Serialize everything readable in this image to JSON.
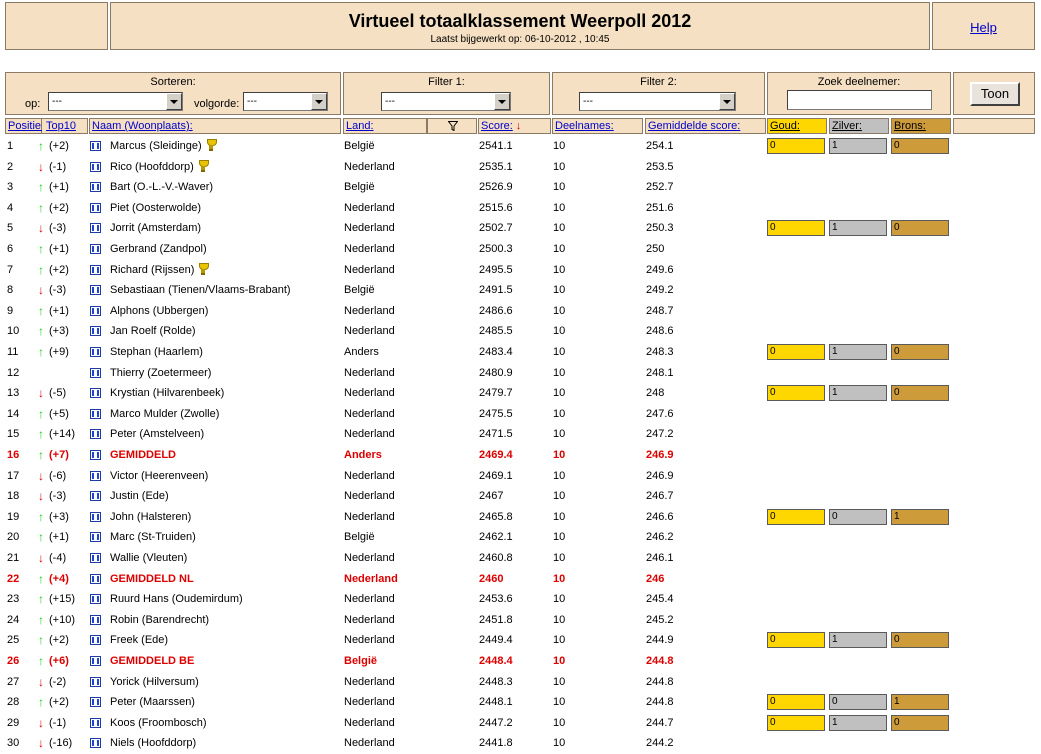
{
  "header": {
    "title": "Virtueel totaalklassement Weerpoll 2012",
    "subtitle": "Laatst bijgewerkt op: 06-10-2012 , 10:45",
    "help": "Help"
  },
  "controls": {
    "sort_label": "Sorteren:",
    "op_label": "op:",
    "op_value": "---",
    "volgorde_label": "volgorde:",
    "volgorde_value": "---",
    "filter1_label": "Filter 1:",
    "filter1_value": "---",
    "filter2_label": "Filter 2:",
    "filter2_value": "---",
    "search_label": "Zoek deelnemer:",
    "search_value": "",
    "show_button": "Toon"
  },
  "columns": {
    "positie": "Positie:",
    "top10": "Top10",
    "naam": "Naam (Woonplaats):",
    "land": "Land:",
    "score": "Score:",
    "deelnames": "Deelnames:",
    "gemiddelde": "Gemiddelde score:",
    "goud": "Goud:",
    "zilver": "Zilver:",
    "brons": "Brons:"
  },
  "icons": {
    "filter": "filter-funnel-icon",
    "sort": "sort-down-arrow-icon",
    "up": "↑",
    "down": "↓",
    "team": "profile-icon",
    "trophy": "trophy-icon"
  },
  "colors": {
    "panel": "#f5e0c3",
    "gold": "#ffd700",
    "silver": "#c0c0c0",
    "bronze": "#cd9b3a",
    "highlight": "#dd0000",
    "up": "#22cc22",
    "down": "#dd0000"
  },
  "rows": [
    {
      "pos": "1",
      "dir": "up",
      "change": "(+2)",
      "name": "Marcus (Sleidinge)",
      "trophy": true,
      "land": "België",
      "score": "2541.1",
      "deel": "10",
      "gem": "254.1",
      "medals": [
        "0",
        "1",
        "0"
      ]
    },
    {
      "pos": "2",
      "dir": "down",
      "change": "(-1)",
      "name": "Rico (Hoofddorp)",
      "trophy": true,
      "land": "Nederland",
      "score": "2535.1",
      "deel": "10",
      "gem": "253.5"
    },
    {
      "pos": "3",
      "dir": "up",
      "change": "(+1)",
      "name": "Bart (O.-L.-V.-Waver)",
      "land": "België",
      "score": "2526.9",
      "deel": "10",
      "gem": "252.7"
    },
    {
      "pos": "4",
      "dir": "up",
      "change": "(+2)",
      "name": "Piet (Oosterwolde)",
      "land": "Nederland",
      "score": "2515.6",
      "deel": "10",
      "gem": "251.6"
    },
    {
      "pos": "5",
      "dir": "down",
      "change": "(-3)",
      "name": "Jorrit (Amsterdam)",
      "land": "Nederland",
      "score": "2502.7",
      "deel": "10",
      "gem": "250.3",
      "medals": [
        "0",
        "1",
        "0"
      ]
    },
    {
      "pos": "6",
      "dir": "up",
      "change": "(+1)",
      "name": "Gerbrand (Zandpol)",
      "land": "Nederland",
      "score": "2500.3",
      "deel": "10",
      "gem": "250"
    },
    {
      "pos": "7",
      "dir": "up",
      "change": "(+2)",
      "name": "Richard (Rijssen)",
      "trophy": true,
      "land": "Nederland",
      "score": "2495.5",
      "deel": "10",
      "gem": "249.6"
    },
    {
      "pos": "8",
      "dir": "down",
      "change": "(-3)",
      "name": "Sebastiaan (Tienen/Vlaams-Brabant)",
      "land": "België",
      "score": "2491.5",
      "deel": "10",
      "gem": "249.2"
    },
    {
      "pos": "9",
      "dir": "up",
      "change": "(+1)",
      "name": "Alphons (Ubbergen)",
      "land": "Nederland",
      "score": "2486.6",
      "deel": "10",
      "gem": "248.7"
    },
    {
      "pos": "10",
      "dir": "up",
      "change": "(+3)",
      "name": "Jan Roelf (Rolde)",
      "land": "Nederland",
      "score": "2485.5",
      "deel": "10",
      "gem": "248.6"
    },
    {
      "pos": "11",
      "dir": "up",
      "change": "(+9)",
      "name": "Stephan (Haarlem)",
      "land": "Anders",
      "score": "2483.4",
      "deel": "10",
      "gem": "248.3",
      "medals": [
        "0",
        "1",
        "0"
      ]
    },
    {
      "pos": "12",
      "dir": "",
      "change": "",
      "name": "Thierry (Zoetermeer)",
      "land": "Nederland",
      "score": "2480.9",
      "deel": "10",
      "gem": "248.1"
    },
    {
      "pos": "13",
      "dir": "down",
      "change": "(-5)",
      "name": "Krystian (Hilvarenbeek)",
      "land": "Nederland",
      "score": "2479.7",
      "deel": "10",
      "gem": "248",
      "medals": [
        "0",
        "1",
        "0"
      ]
    },
    {
      "pos": "14",
      "dir": "up",
      "change": "(+5)",
      "name": "Marco Mulder (Zwolle)",
      "land": "Nederland",
      "score": "2475.5",
      "deel": "10",
      "gem": "247.6"
    },
    {
      "pos": "15",
      "dir": "up",
      "change": "(+14)",
      "name": "Peter (Amstelveen)",
      "land": "Nederland",
      "score": "2471.5",
      "deel": "10",
      "gem": "247.2"
    },
    {
      "pos": "16",
      "dir": "up",
      "change": "(+7)",
      "name": "GEMIDDELD",
      "gem_row": true,
      "land": "Anders",
      "score": "2469.4",
      "deel": "10",
      "gem": "246.9"
    },
    {
      "pos": "17",
      "dir": "down",
      "change": "(-6)",
      "name": "Victor (Heerenveen)",
      "land": "Nederland",
      "score": "2469.1",
      "deel": "10",
      "gem": "246.9"
    },
    {
      "pos": "18",
      "dir": "down",
      "change": "(-3)",
      "name": "Justin (Ede)",
      "land": "Nederland",
      "score": "2467",
      "deel": "10",
      "gem": "246.7"
    },
    {
      "pos": "19",
      "dir": "up",
      "change": "(+3)",
      "name": "John (Halsteren)",
      "land": "Nederland",
      "score": "2465.8",
      "deel": "10",
      "gem": "246.6",
      "medals": [
        "0",
        "0",
        "1"
      ]
    },
    {
      "pos": "20",
      "dir": "up",
      "change": "(+1)",
      "name": "Marc (St-Truiden)",
      "land": "België",
      "score": "2462.1",
      "deel": "10",
      "gem": "246.2"
    },
    {
      "pos": "21",
      "dir": "down",
      "change": "(-4)",
      "name": "Wallie (Vleuten)",
      "land": "Nederland",
      "score": "2460.8",
      "deel": "10",
      "gem": "246.1"
    },
    {
      "pos": "22",
      "dir": "up",
      "change": "(+4)",
      "name": "GEMIDDELD NL",
      "gem_row": true,
      "land": "Nederland",
      "score": "2460",
      "deel": "10",
      "gem": "246"
    },
    {
      "pos": "23",
      "dir": "up",
      "change": "(+15)",
      "name": "Ruurd Hans (Oudemirdum)",
      "land": "Nederland",
      "score": "2453.6",
      "deel": "10",
      "gem": "245.4"
    },
    {
      "pos": "24",
      "dir": "up",
      "change": "(+10)",
      "name": "Robin (Barendrecht)",
      "land": "Nederland",
      "score": "2451.8",
      "deel": "10",
      "gem": "245.2"
    },
    {
      "pos": "25",
      "dir": "up",
      "change": "(+2)",
      "name": "Freek (Ede)",
      "land": "Nederland",
      "score": "2449.4",
      "deel": "10",
      "gem": "244.9",
      "medals": [
        "0",
        "1",
        "0"
      ]
    },
    {
      "pos": "26",
      "dir": "up",
      "change": "(+6)",
      "name": "GEMIDDELD BE",
      "gem_row": true,
      "land": "België",
      "score": "2448.4",
      "deel": "10",
      "gem": "244.8"
    },
    {
      "pos": "27",
      "dir": "down",
      "change": "(-2)",
      "name": "Yorick (Hilversum)",
      "land": "Nederland",
      "score": "2448.3",
      "deel": "10",
      "gem": "244.8"
    },
    {
      "pos": "28",
      "dir": "up",
      "change": "(+2)",
      "name": "Peter (Maarssen)",
      "land": "Nederland",
      "score": "2448.1",
      "deel": "10",
      "gem": "244.8",
      "medals": [
        "0",
        "0",
        "1"
      ]
    },
    {
      "pos": "29",
      "dir": "down",
      "change": "(-1)",
      "name": "Koos (Froombosch)",
      "land": "Nederland",
      "score": "2447.2",
      "deel": "10",
      "gem": "244.7",
      "medals": [
        "0",
        "1",
        "0"
      ]
    },
    {
      "pos": "30",
      "dir": "down",
      "change": "(-16)",
      "name": "Niels (Hoofddorp)",
      "land": "Nederland",
      "score": "2441.8",
      "deel": "10",
      "gem": "244.2"
    }
  ]
}
